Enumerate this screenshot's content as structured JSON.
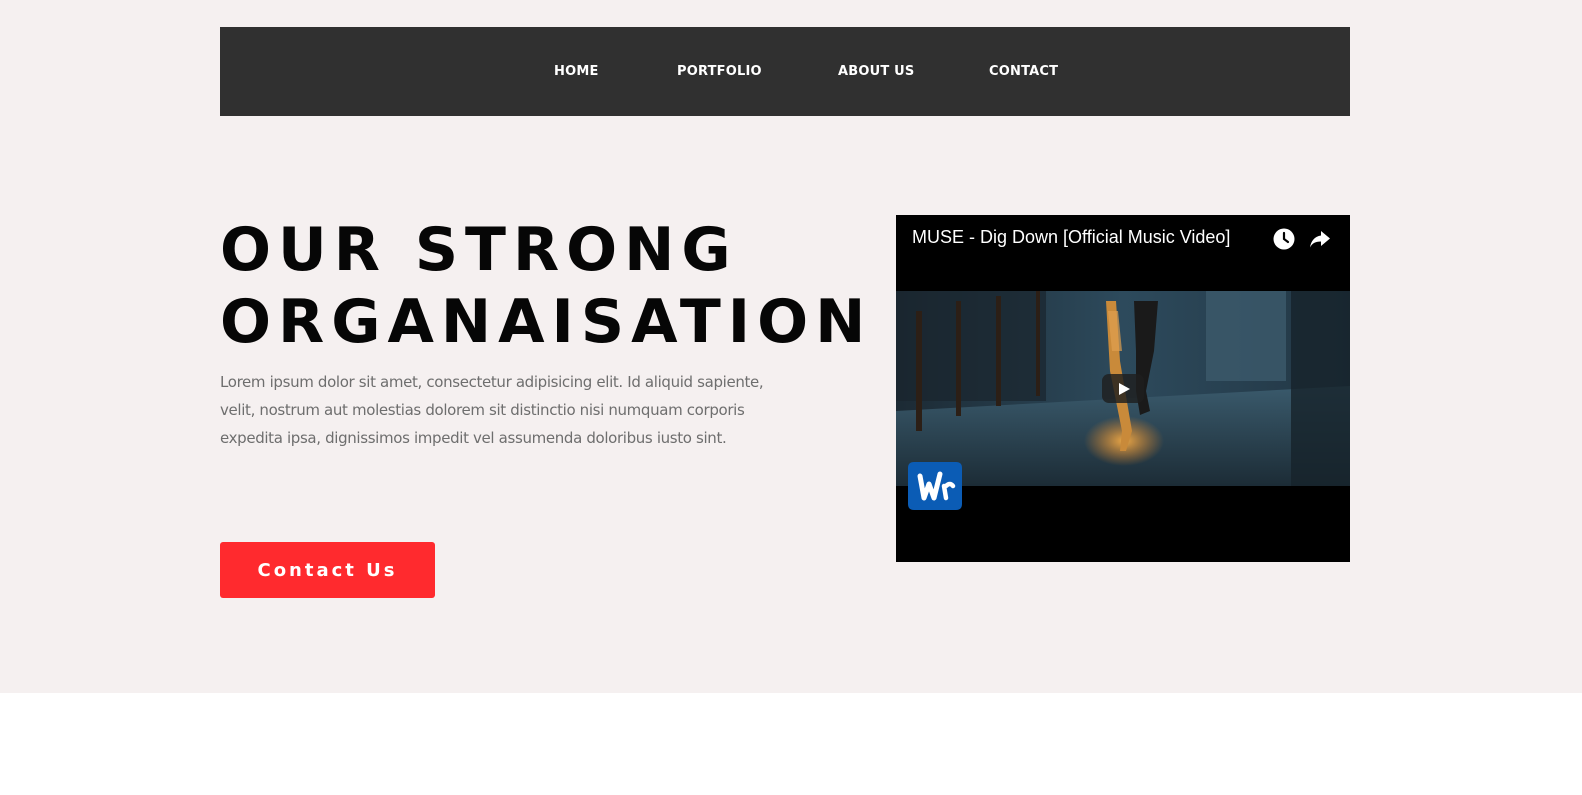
{
  "nav": {
    "items": [
      {
        "label": "HOME"
      },
      {
        "label": "PORTFOLIO"
      },
      {
        "label": "ABOUT US"
      },
      {
        "label": "CONTACT"
      }
    ]
  },
  "hero": {
    "headline_line1": "OUR STRONG",
    "headline_line2": "ORGANAISATION",
    "body": "Lorem ipsum dolor sit amet, consectetur adipisicing elit. Id aliquid sapiente, velit, nostrum aut molestias dolorem sit distinctio nisi numquam corporis expedita ipsa, dignissimos impedit vel assumenda doloribus iusto sint.",
    "cta_label": "Contact Us"
  },
  "video": {
    "title": "MUSE - Dig Down [Official Music Video]",
    "icons": [
      "watch-later-icon",
      "share-icon",
      "play-icon",
      "channel-logo-icon"
    ]
  },
  "colors": {
    "page_background": "#f5f0f0",
    "nav_background": "#303030",
    "cta_background": "#ff2a2e",
    "headline": "#060606",
    "body_text": "#6e6e6e",
    "channel_logo": "#0b5cb5"
  }
}
